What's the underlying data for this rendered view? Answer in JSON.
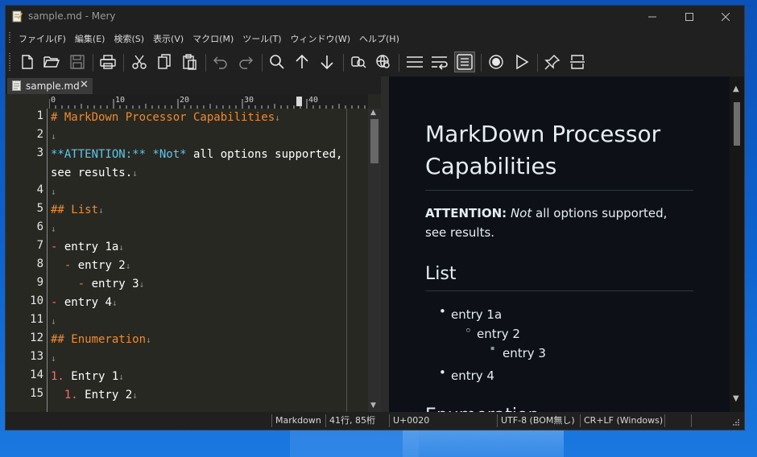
{
  "window": {
    "title": "sample.md - Mery",
    "colors": {
      "background": "#2b2b2b",
      "chrome": "#202020",
      "editor_bg": "#272822",
      "preview_bg": "#0d1117"
    }
  },
  "menu": {
    "items": [
      "ファイル(F)",
      "編集(E)",
      "検索(S)",
      "表示(V)",
      "マクロ(M)",
      "ツール(T)",
      "ウィンドウ(W)",
      "ヘルプ(H)"
    ]
  },
  "toolbar": {
    "icons": [
      "new-file-icon",
      "open-folder-icon",
      "save-icon",
      "print-icon",
      "cut-icon",
      "copy-icon",
      "paste-icon",
      "undo-icon",
      "redo-icon",
      "search-icon",
      "find-previous-icon",
      "find-next-icon",
      "replace-icon",
      "web-search-icon",
      "align-icon",
      "word-wrap-icon",
      "wrap-window-icon",
      "record-macro-icon",
      "run-macro-icon",
      "pin-icon",
      "split-window-icon"
    ]
  },
  "tab": {
    "label": "sample.md",
    "close": "✕"
  },
  "editor": {
    "ruler": [
      "0",
      "10",
      "20",
      "30",
      "40"
    ],
    "line_numbers": [
      "1",
      "2",
      "3",
      "",
      "4",
      "5",
      "6",
      "7",
      "8",
      "9",
      "10",
      "11",
      "12",
      "13",
      "14",
      "15"
    ],
    "eol_mark": "↓",
    "lines": [
      {
        "marker": "# MarkDown Processor Capabilities",
        "text": ""
      },
      {
        "marker": "",
        "text": ""
      },
      {
        "marker": "**ATTENTION:** *Not*",
        "text": " all options supported,"
      },
      {
        "marker": "",
        "text": "see results."
      },
      {
        "marker": "",
        "text": ""
      },
      {
        "marker": "## List",
        "text": ""
      },
      {
        "marker": "",
        "text": ""
      },
      {
        "marker": "-",
        "text": " entry 1a"
      },
      {
        "marker": "  -",
        "text": " entry 2"
      },
      {
        "marker": "    -",
        "text": " entry 3"
      },
      {
        "marker": "-",
        "text": " entry 4"
      },
      {
        "marker": "",
        "text": ""
      },
      {
        "marker": "## Enumeration",
        "text": ""
      },
      {
        "marker": "",
        "text": ""
      },
      {
        "marker": "1.",
        "text": " Entry 1"
      },
      {
        "marker": "  1.",
        "text": " Entry 2"
      }
    ]
  },
  "preview": {
    "h1": "MarkDown Processor Capabilities",
    "attention_label": "ATTENTION:",
    "not_label": "Not",
    "attention_text": " all options supported, see results.",
    "h2_list": "List",
    "list": [
      {
        "text": "entry 1a",
        "bullet": "•"
      },
      {
        "text": "entry 2",
        "bullet": "◦"
      },
      {
        "text": "entry 3",
        "bullet": "▪"
      },
      {
        "text": "entry 4",
        "bullet": "•"
      }
    ],
    "h2_enum": "Enumeration"
  },
  "status": {
    "mode": "Markdown",
    "position": "41行, 85桁",
    "codepoint": "U+0020",
    "encoding": "UTF-8 (BOM無し)",
    "line_ending": "CR+LF (Windows)"
  }
}
